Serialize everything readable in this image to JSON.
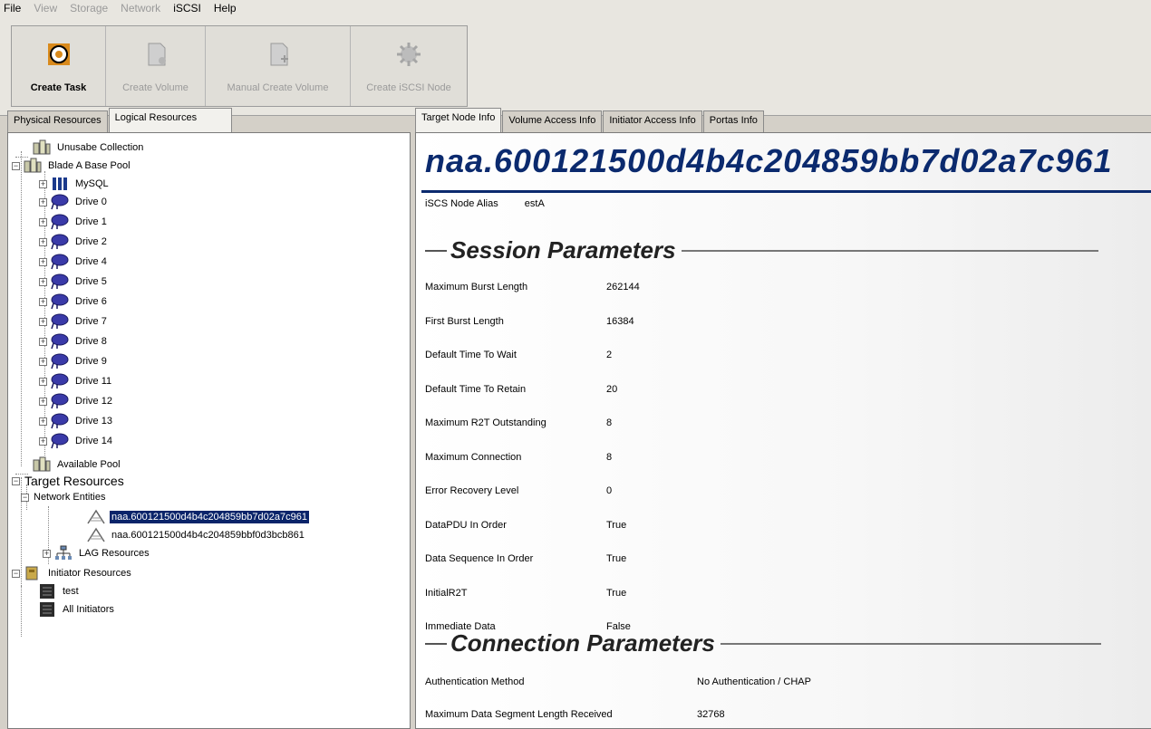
{
  "menu": [
    "File",
    "View",
    "Storage",
    "Network",
    "iSCSI",
    "Help"
  ],
  "toolbar": {
    "buttons": [
      {
        "label": "Create Task",
        "icon": "create-task-icon"
      },
      {
        "label": "Create Volume",
        "icon": "create-volume-icon"
      },
      {
        "label": "Manual Create Volume",
        "icon": "manual-create-volume-icon"
      },
      {
        "label": "Create iSCSI Node",
        "icon": "create-iscsi-node-icon"
      }
    ]
  },
  "left_tabs": [
    "Physical Resources",
    "Logical Resources"
  ],
  "tree": {
    "unusable": "Unusabe Collection",
    "base_pool": "Blade A Base Pool",
    "mysql": "MySQL",
    "drives": [
      "Drive 0",
      "Drive 1",
      "Drive 2",
      "Drive 4",
      "Drive 5",
      "Drive 6",
      "Drive 7",
      "Drive 8",
      "Drive 9",
      "Drive 11",
      "Drive 12",
      "Drive 13",
      "Drive 14"
    ],
    "available_pool": "Available Pool",
    "target_resources": "Target Resources",
    "network_entities": "Network Entities",
    "node1": "naa.600121500d4b4c204859bb7d02a7c961",
    "node2": "naa.600121500d4b4c204859bbf0d3bcb861",
    "lag": "LAG Resources",
    "initiator_resources": "Initiator Resources",
    "test": "test",
    "all_initiators": "All Initiators"
  },
  "right_tabs": [
    "Target Node Info",
    "Volume Access Info",
    "Initiator Access Info",
    "Portas Info"
  ],
  "node": {
    "title": "naa.600121500d4b4c204859bb7d02a7c961",
    "alias_label": "iSCS Node Alias",
    "alias_value": "estA"
  },
  "session": {
    "heading": "Session Parameters",
    "params": [
      {
        "k": "Maximum Burst Length",
        "v": "262144"
      },
      {
        "k": "First Burst Length",
        "v": "16384"
      },
      {
        "k": "Default Time To Wait",
        "v": "2"
      },
      {
        "k": "Default Time To Retain",
        "v": "20"
      },
      {
        "k": "Maximum R2T Outstanding",
        "v": "8"
      },
      {
        "k": "Maximum Connection",
        "v": "8"
      },
      {
        "k": "Error Recovery Level",
        "v": "0"
      },
      {
        "k": "DataPDU In Order",
        "v": "True"
      },
      {
        "k": "Data Sequence In Order",
        "v": "True"
      },
      {
        "k": "InitialR2T",
        "v": "True"
      },
      {
        "k": "Immediate Data",
        "v": "False"
      }
    ]
  },
  "connection": {
    "heading": "Connection Parameters",
    "params": [
      {
        "k": "Authentication Method",
        "v": "No Authentication / CHAP"
      },
      {
        "k": "Maximum Data Segment Length Received",
        "v": "32768"
      }
    ]
  },
  "colors": {
    "accent": "#0b2a6e",
    "selection": "#0a246a"
  }
}
